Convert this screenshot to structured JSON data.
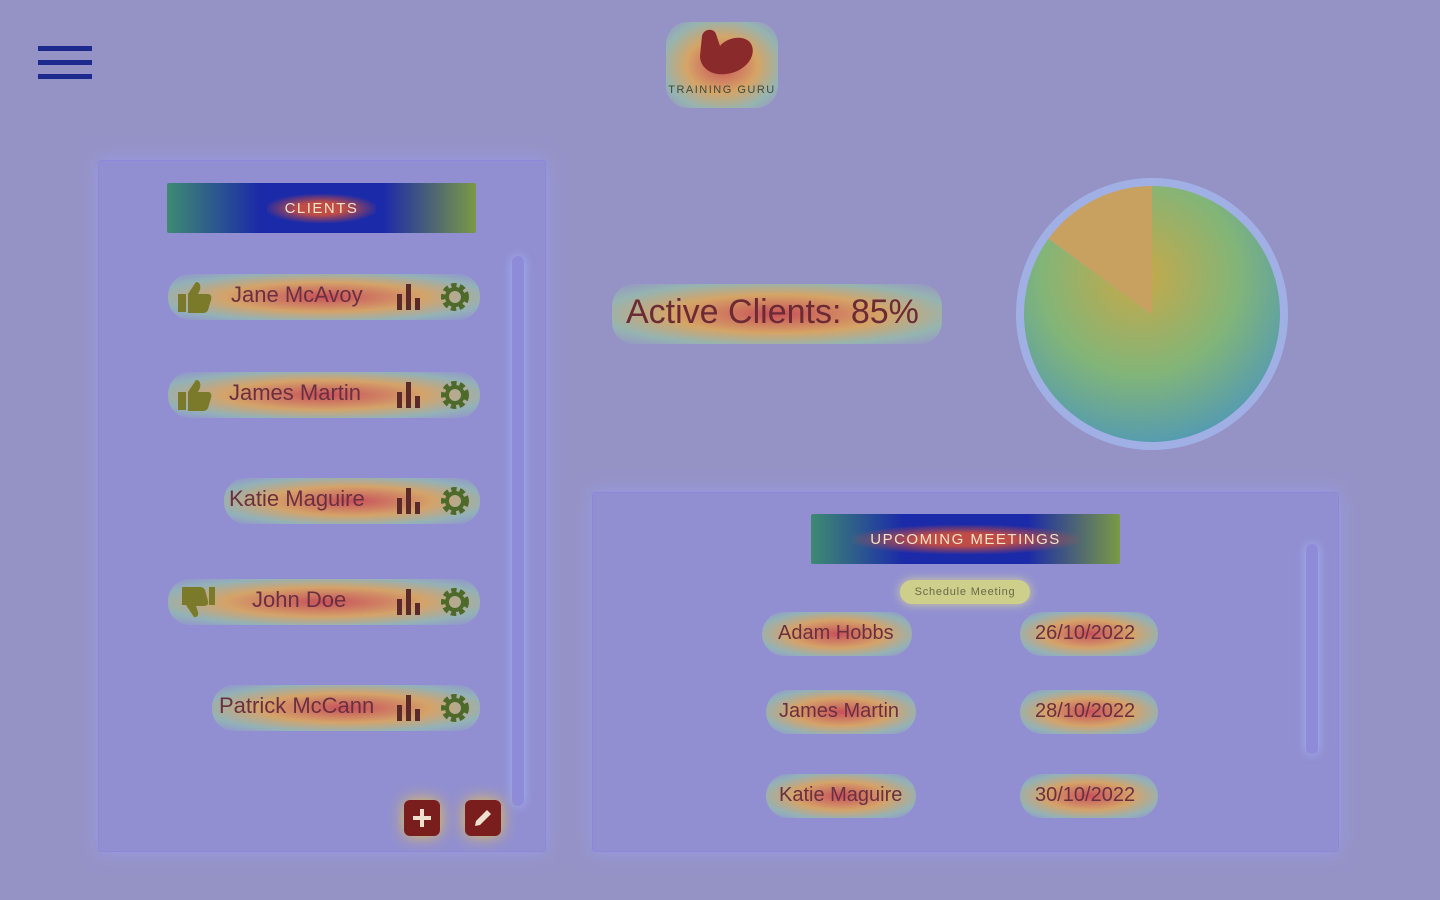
{
  "app": {
    "brand": "TRAINING GURU"
  },
  "clients": {
    "header": "CLIENTS",
    "items": [
      {
        "name": "Jane McAvoy",
        "rating": "up"
      },
      {
        "name": "James Martin",
        "rating": "up"
      },
      {
        "name": "Katie Maguire",
        "rating": "none"
      },
      {
        "name": "John Doe",
        "rating": "down"
      },
      {
        "name": "Patrick McCann",
        "rating": "none"
      }
    ]
  },
  "stats": {
    "active_clients_label": "Active Clients: 85%",
    "active_fraction": 0.85
  },
  "meetings": {
    "header": "UPCOMING MEETINGS",
    "schedule_label": "Schedule Meeting",
    "items": [
      {
        "name": "Adam Hobbs",
        "date": "26/10/2022"
      },
      {
        "name": "James Martin",
        "date": "28/10/2022"
      },
      {
        "name": "Katie Maguire",
        "date": "30/10/2022"
      }
    ]
  },
  "colors": {
    "background": "#9593c6",
    "header_blue": "#1b2aa8",
    "fab": "#7a1d1d",
    "icon_olive": "#6b6a2a"
  }
}
